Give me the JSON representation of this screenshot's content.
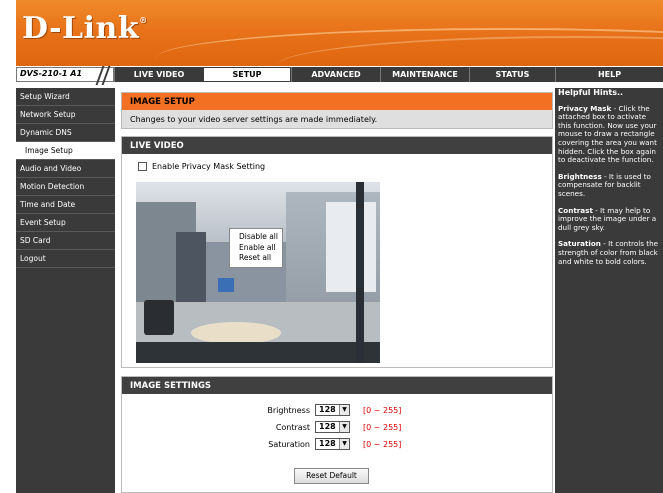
{
  "brand": {
    "logo_text": "D-Link",
    "logo_mark": "®"
  },
  "nav": {
    "model": "DVS-210-1 A1",
    "tabs": [
      {
        "label": "LIVE VIDEO"
      },
      {
        "label": "SETUP"
      },
      {
        "label": "ADVANCED"
      },
      {
        "label": "MAINTENANCE"
      },
      {
        "label": "STATUS"
      },
      {
        "label": "HELP"
      }
    ],
    "active_tab": "SETUP"
  },
  "sidebar": {
    "items": [
      {
        "label": "Setup Wizard"
      },
      {
        "label": "Network Setup"
      },
      {
        "label": "Dynamic DNS"
      },
      {
        "label": "Image Setup"
      },
      {
        "label": "Audio and Video"
      },
      {
        "label": "Motion Detection"
      },
      {
        "label": "Time and Date"
      },
      {
        "label": "Event Setup"
      },
      {
        "label": "SD Card"
      },
      {
        "label": "Logout"
      }
    ],
    "active_item": "Image Setup"
  },
  "image_setup": {
    "title": "IMAGE SETUP",
    "description": "Changes to your video server settings are made immediately."
  },
  "live_video": {
    "title": "LIVE VIDEO",
    "privacy_label": "Enable Privacy Mask Setting",
    "privacy_checked": false,
    "context_menu": [
      "Disable all",
      "Enable all",
      "Reset all"
    ]
  },
  "image_settings": {
    "title": "IMAGE SETTINGS",
    "rows": [
      {
        "label": "Brightness",
        "value": "128",
        "range": "[0 ~ 255]"
      },
      {
        "label": "Contrast",
        "value": "128",
        "range": "[0 ~ 255]"
      },
      {
        "label": "Saturation",
        "value": "128",
        "range": "[0 ~ 255]"
      }
    ],
    "reset_label": "Reset Default"
  },
  "hints": {
    "title": "Helpful Hints..",
    "items": [
      {
        "term": "Privacy Mask",
        "text": " - Click the attached box to activate this function. Now use your mouse to draw a rectangle covering the area you want hidden. Click the box again to deactivate the function."
      },
      {
        "term": "Brightness",
        "text": " - It is used to compensate for backlit scenes."
      },
      {
        "term": "Contrast",
        "text": " - It may help to improve the image under a dull grey sky."
      },
      {
        "term": "Saturation",
        "text": " - It controls the strength of color from black and white to bold colors."
      }
    ]
  },
  "colors": {
    "accent": "#f36f21",
    "dark": "#3a3a3a",
    "range_text": "#dd0000"
  }
}
